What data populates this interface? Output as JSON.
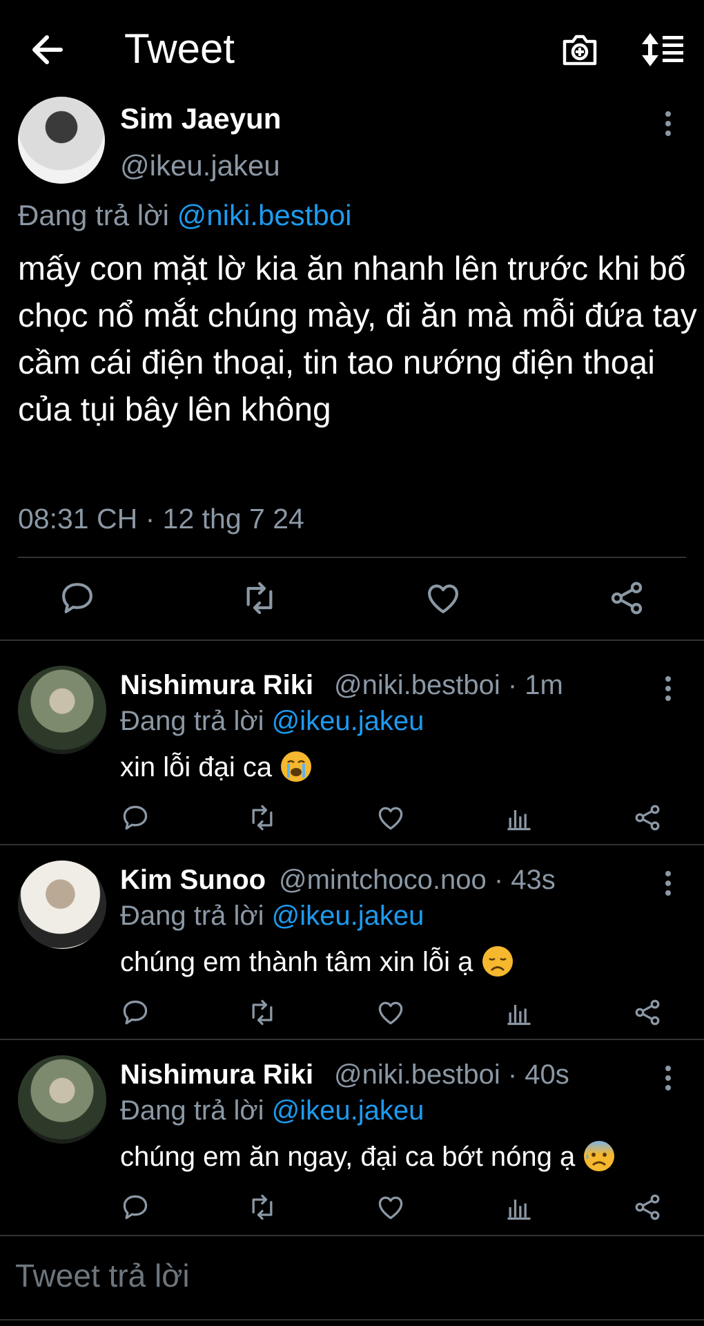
{
  "header": {
    "title": "Tweet",
    "back_icon": "arrow-left-icon",
    "camera_icon": "camera-plus-icon",
    "sort_icon": "sort-icon"
  },
  "tweet": {
    "author": {
      "name": "Sim Jaeyun",
      "handle": "@ikeu.jakeu"
    },
    "replying_prefix": "Đang trả lời",
    "replying_to": "@niki.bestboi",
    "text": "mấy con mặt lờ kia ăn nhanh lên trước khi bố chọc nổ mắt chúng mày, đi ăn mà mỗi đứa tay cầm cái điện thoại, tin tao nướng điện thoại của tụi bây lên không",
    "timestamp": "08:31 CH · 12 thg 7 24",
    "actions": [
      "reply-icon",
      "retweet-icon",
      "like-icon",
      "share-icon"
    ]
  },
  "replies": [
    {
      "name": "Nishimura Riki",
      "handle": "@niki.bestboi · 1m",
      "replying_prefix": "Đang trả lời",
      "replying_to": "@ikeu.jakeu",
      "text": "xin lỗi đại ca",
      "emoji": "loudly-crying-face"
    },
    {
      "name": "Kim Sunoo",
      "handle": "@mintchoco.noo · 43s",
      "replying_prefix": "Đang trả lời",
      "replying_to": "@ikeu.jakeu",
      "text": "chúng em thành tâm xin lỗi ạ",
      "emoji": "disappointed-face"
    },
    {
      "name": "Nishimura Riki",
      "handle": "@niki.bestboi · 40s",
      "replying_prefix": "Đang trả lời",
      "replying_to": "@ikeu.jakeu",
      "text": "chúng em ăn ngay, đại ca bớt nóng ạ",
      "emoji": "anxious-face-with-sweat"
    }
  ],
  "compose": {
    "placeholder": "Tweet trả lời"
  },
  "colors": {
    "background": "#000000",
    "text": "#e7e9ea",
    "secondary": "#8b98a5",
    "link": "#1d9bf0",
    "divider": "#2f3336",
    "emoji": "#f5b82e"
  }
}
